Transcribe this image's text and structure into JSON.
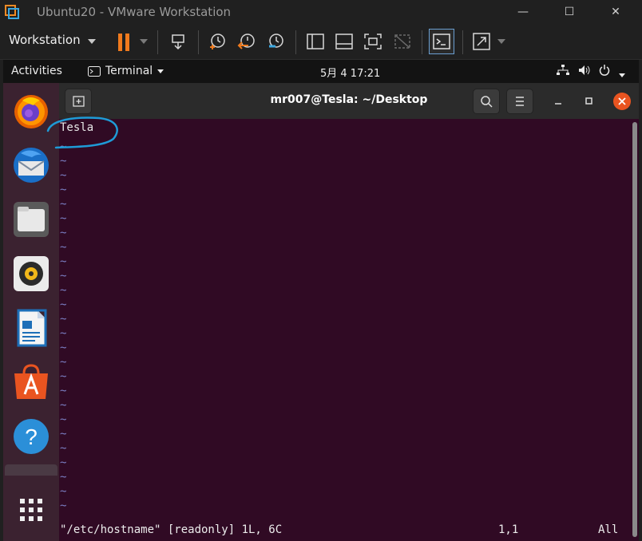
{
  "vm_window": {
    "title": "Ubuntu20 - VMware Workstation",
    "menu_label": "Workstation"
  },
  "gnome_topbar": {
    "activities": "Activities",
    "app_name": "Terminal",
    "clock": "5月 4  17:21"
  },
  "dock": {
    "apps": [
      "firefox-icon",
      "thunderbird-icon",
      "files-icon",
      "rhythmbox-icon",
      "libreoffice-writer-icon",
      "ubuntu-software-icon",
      "help-icon",
      "show-apps-icon"
    ]
  },
  "terminal": {
    "title": "mr007@Tesla: ~/Desktop",
    "content_first_line": "Tesla",
    "empty_line_marker": "~",
    "status_file": "\"/etc/hostname\" [readonly] 1L, 6C",
    "status_position": "1,1",
    "status_scroll": "All"
  },
  "colors": {
    "terminal_bg": "#300a24",
    "tilde": "#7b7fc4",
    "close_button": "#e95420",
    "pause_orange": "#f07a1d"
  }
}
